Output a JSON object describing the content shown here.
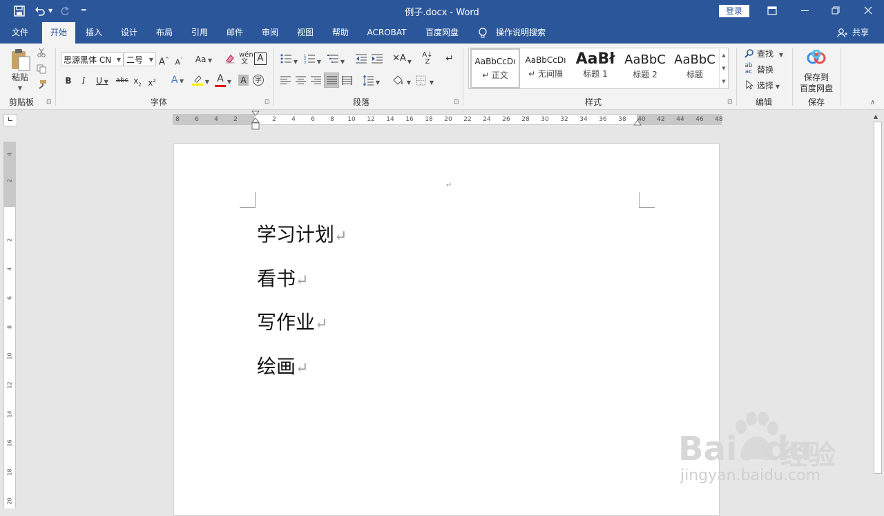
{
  "window": {
    "title": "例子.docx  -  Word",
    "login_label": "登录"
  },
  "tabs": [
    {
      "label": "文件"
    },
    {
      "label": "开始"
    },
    {
      "label": "插入"
    },
    {
      "label": "设计"
    },
    {
      "label": "布局"
    },
    {
      "label": "引用"
    },
    {
      "label": "邮件"
    },
    {
      "label": "审阅"
    },
    {
      "label": "视图"
    },
    {
      "label": "帮助"
    },
    {
      "label": "ACROBAT"
    },
    {
      "label": "百度网盘"
    }
  ],
  "tell_me": "操作说明搜索",
  "share_label": "共享",
  "ribbon": {
    "clipboard": {
      "label": "剪贴板",
      "paste": "粘贴"
    },
    "font": {
      "label": "字体",
      "font_name": "思源黑体 CN",
      "font_size": "二号",
      "case": "Aa"
    },
    "paragraph": {
      "label": "段落"
    },
    "styles": {
      "label": "样式",
      "items": [
        {
          "preview": "AaBbCcDı",
          "name": "↵ 正文"
        },
        {
          "preview": "AaBbCcDı",
          "name": "↵ 无间隔"
        },
        {
          "preview": "AaBł",
          "name": "标题 1"
        },
        {
          "preview": "AaBbC",
          "name": "标题 2"
        },
        {
          "preview": "AaBbC",
          "name": "标题"
        }
      ]
    },
    "editing": {
      "label": "编辑",
      "find": "查找",
      "replace": "替换",
      "select": "选择"
    },
    "save": {
      "label": "保存",
      "button_line1": "保存到",
      "button_line2": "百度网盘"
    }
  },
  "ruler": {
    "h_left": [
      "8",
      "6",
      "4",
      "2"
    ],
    "h_right": [
      "2",
      "4",
      "6",
      "8",
      "10",
      "12",
      "14",
      "16",
      "18",
      "20",
      "22",
      "24",
      "26",
      "28",
      "30",
      "32",
      "34",
      "36",
      "38",
      "40",
      "42",
      "44",
      "46",
      "48"
    ],
    "v": [
      "4",
      "2",
      "2",
      "4",
      "6",
      "8",
      "10",
      "12",
      "14",
      "16",
      "18",
      "20"
    ]
  },
  "document": {
    "top_mark": "↵",
    "lines": [
      "学习计划",
      "看书",
      "写作业",
      "绘画"
    ],
    "para_mark": "↵"
  },
  "watermark": {
    "brand": "Bai",
    "brand2": "du",
    "cn": "经验",
    "url": "jingyan.baidu.com"
  },
  "colors": {
    "accent": "#2b579a",
    "ribbon_bg": "#f3f3f3"
  }
}
